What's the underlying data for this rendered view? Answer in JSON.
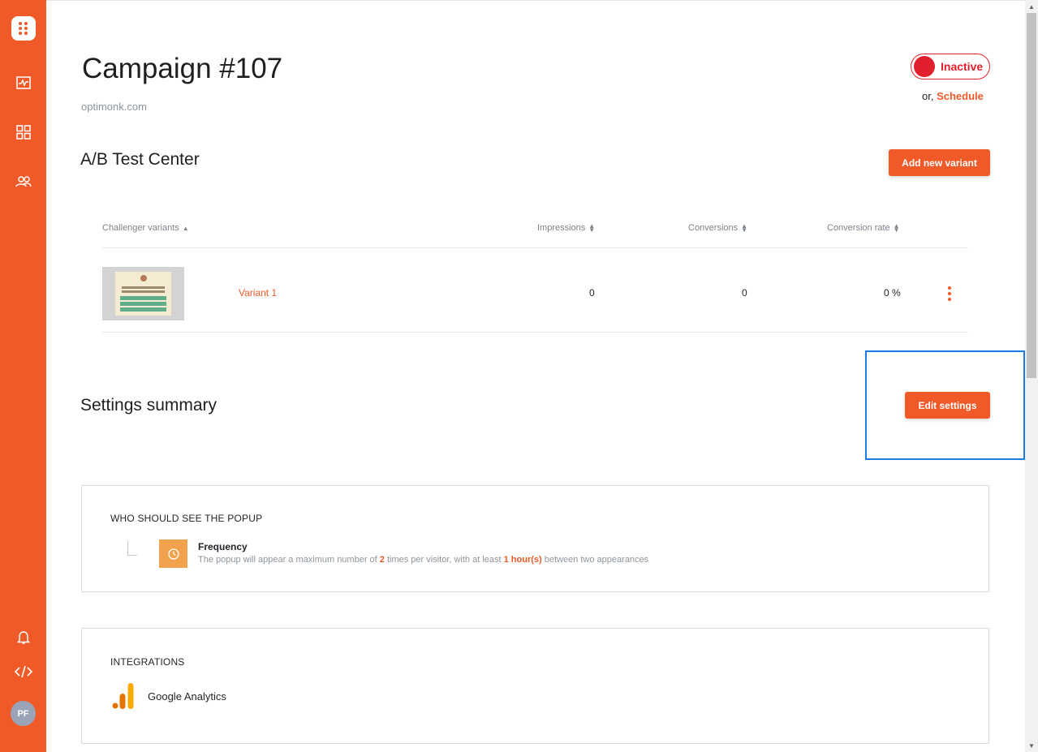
{
  "sidebar": {
    "nav": [
      "analytics-icon",
      "campaigns-grid-icon",
      "users-icon"
    ],
    "bottom": [
      "bell-icon",
      "code-icon"
    ],
    "avatar": "PF"
  },
  "header": {
    "title": "Campaign #107",
    "domain": "optimonk.com",
    "status_label": "Inactive",
    "schedule_prefix": "or,",
    "schedule_link": "Schedule"
  },
  "ab_test": {
    "title": "A/B Test Center",
    "add_button": "Add new variant",
    "columns": [
      "Challenger variants",
      "Impressions",
      "Conversions",
      "Conversion rate"
    ],
    "rows": [
      {
        "name": "Variant 1",
        "impressions": "0",
        "conversions": "0",
        "conversion_rate": "0 %"
      }
    ]
  },
  "settings": {
    "title": "Settings summary",
    "edit_button": "Edit settings"
  },
  "who_should_see": {
    "title": "WHO SHOULD SEE THE POPUP",
    "frequency_title": "Frequency",
    "desc_1": "The popup will appear a maximum number of ",
    "times": "2",
    "desc_2": " times per visitor, with at least ",
    "hours": "1 hour(s)",
    "desc_3": " between two appearances"
  },
  "integrations": {
    "title": "INTEGRATIONS",
    "item": "Google Analytics"
  },
  "colors": {
    "brand": "#ef5a28",
    "status_inactive": "#e0202d",
    "highlight": "#1e7ae6"
  }
}
